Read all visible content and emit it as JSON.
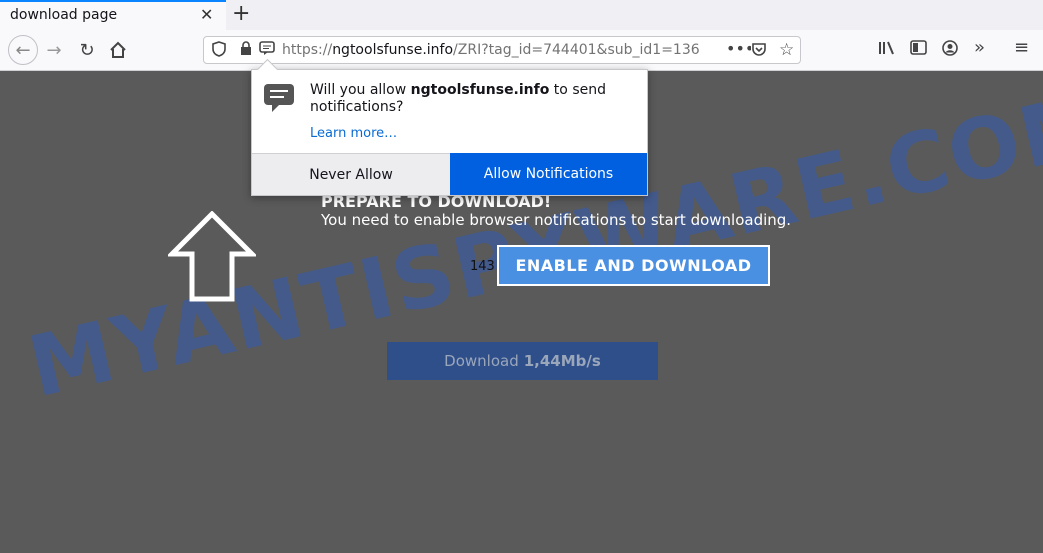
{
  "tab": {
    "title": "download page",
    "close": "✕",
    "new": "+"
  },
  "nav": {
    "url_prefix": "https://",
    "url_host": "ngtoolsfunse.info",
    "url_rest": "/ZRI?tag_id=744401&sub_id1=136"
  },
  "popup": {
    "message_before": "Will you allow ",
    "host": "ngtoolsfunse.info",
    "message_after": " to send notifications?",
    "learn_more": "Learn more…",
    "never_allow": "Never Allow",
    "allow": "Allow Notifications"
  },
  "page": {
    "headline": "PREPARE TO DOWNLOAD!",
    "subline": "You need to enable browser notifications to start downloading.",
    "count": "143",
    "enable_button": "ENABLE AND DOWNLOAD",
    "download_label": "Download",
    "download_speed": "1,44Mb/s",
    "watermark": "MYANTISPYWARE.COM"
  },
  "colors": {
    "accent": "#0060df",
    "enable_bg": "#4a90e2",
    "page_bg": "#5a5a5a"
  }
}
